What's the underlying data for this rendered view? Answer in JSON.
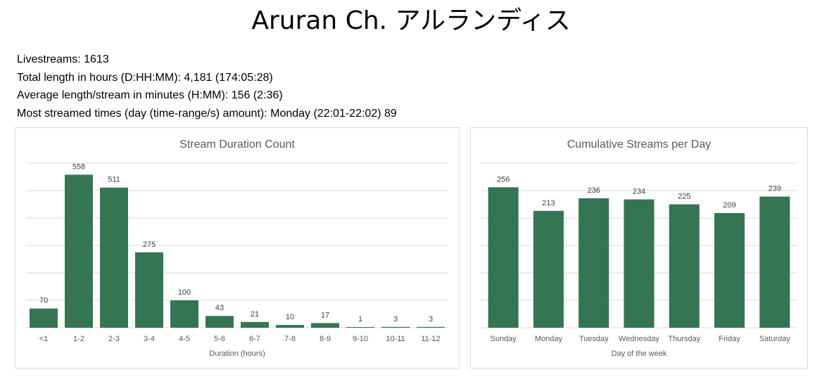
{
  "page": {
    "title": "Aruran Ch. アルランディス"
  },
  "stats": [
    "Livestreams: 1613",
    "Total length in hours (D:HH:MM): 4,181 (174:05:28)",
    "Average length/stream in minutes (H:MM): 156 (2:36)",
    "Most streamed times (day (time-range/s) amount): Monday (22:01-22:02) 89"
  ],
  "colors": {
    "bar": "#357553",
    "gridline": "#d9d9d9",
    "text_muted": "#595959"
  },
  "chart_data": [
    {
      "type": "bar",
      "title": "Stream Duration Count",
      "xlabel": "Duration (hours)",
      "ylabel": "",
      "categories": [
        "<1",
        "1-2",
        "2-3",
        "3-4",
        "4-5",
        "5-6",
        "6-7",
        "7-8",
        "8-9",
        "9-10",
        "10-11",
        "11-12"
      ],
      "values": [
        70,
        558,
        511,
        275,
        100,
        43,
        21,
        10,
        17,
        1,
        3,
        3
      ],
      "ylim": [
        0,
        600
      ],
      "grid": true,
      "data_labels": true,
      "legend": "none"
    },
    {
      "type": "bar",
      "title": "Cumulative Streams per Day",
      "xlabel": "Day of the week",
      "ylabel": "",
      "categories": [
        "Sunday",
        "Monday",
        "Tuesday",
        "Wednesday",
        "Thursday",
        "Friday",
        "Saturday"
      ],
      "values": [
        256,
        213,
        236,
        234,
        225,
        209,
        239
      ],
      "ylim": [
        0,
        300
      ],
      "grid": true,
      "data_labels": true,
      "legend": "none"
    }
  ]
}
